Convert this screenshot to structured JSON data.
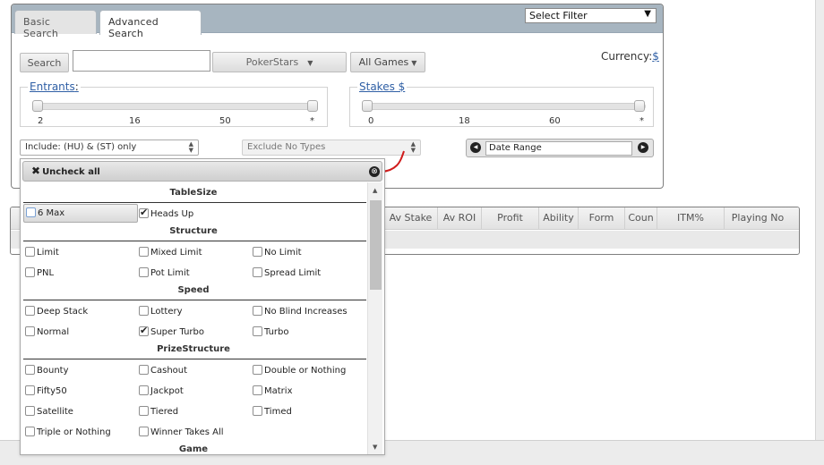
{
  "tabs": {
    "basic": "Basic Search",
    "advanced": "Advanced Search"
  },
  "filter_select": {
    "value": "Select Filter"
  },
  "search": {
    "button": "Search",
    "value": ""
  },
  "site_select": {
    "value": "PokerStars"
  },
  "games_select": {
    "value": "All Games"
  },
  "currency": {
    "label": "Currency:",
    "value": "$"
  },
  "entrants": {
    "title": "Entrants",
    "suffix": ":",
    "ticks": [
      "2",
      "16",
      "50",
      "*"
    ]
  },
  "stakes": {
    "title": "Stakes $",
    "ticks": [
      "0",
      "18",
      "60",
      "*"
    ]
  },
  "include_select": {
    "value": "Include: (HU) & (ST) only"
  },
  "exclude_select": {
    "value": "Exclude No Types"
  },
  "date_range": {
    "value": "Date Range"
  },
  "results_columns": [
    "Av Stake",
    "Av ROI",
    "Profit",
    "Ability",
    "Form",
    "Coun",
    "ITM%",
    "Playing No"
  ],
  "dropdown": {
    "uncheck_all": "Uncheck all",
    "sections": {
      "tablesize": {
        "title": "TableSize",
        "options": [
          {
            "label": "6 Max",
            "checked": false
          },
          {
            "label": "Heads Up",
            "checked": true
          }
        ]
      },
      "structure": {
        "title": "Structure",
        "options": [
          {
            "label": "Limit",
            "checked": false
          },
          {
            "label": "Mixed Limit",
            "checked": false
          },
          {
            "label": "No Limit",
            "checked": false
          },
          {
            "label": "PNL",
            "checked": false
          },
          {
            "label": "Pot Limit",
            "checked": false
          },
          {
            "label": "Spread Limit",
            "checked": false
          }
        ]
      },
      "speed": {
        "title": "Speed",
        "options": [
          {
            "label": "Deep Stack",
            "checked": false
          },
          {
            "label": "Lottery",
            "checked": false
          },
          {
            "label": "No Blind Increases",
            "checked": false
          },
          {
            "label": "Normal",
            "checked": false
          },
          {
            "label": "Super Turbo",
            "checked": true
          },
          {
            "label": "Turbo",
            "checked": false
          }
        ]
      },
      "prizestructure": {
        "title": "PrizeStructure",
        "options": [
          {
            "label": "Bounty",
            "checked": false
          },
          {
            "label": "Cashout",
            "checked": false
          },
          {
            "label": "Double or Nothing",
            "checked": false
          },
          {
            "label": "Fifty50",
            "checked": false
          },
          {
            "label": "Jackpot",
            "checked": false
          },
          {
            "label": "Matrix",
            "checked": false
          },
          {
            "label": "Satellite",
            "checked": false
          },
          {
            "label": "Tiered",
            "checked": false
          },
          {
            "label": "Timed",
            "checked": false
          },
          {
            "label": "Triple or Nothing",
            "checked": false
          },
          {
            "label": "Winner Takes All",
            "checked": false
          }
        ]
      },
      "game": {
        "title": "Game"
      }
    }
  }
}
